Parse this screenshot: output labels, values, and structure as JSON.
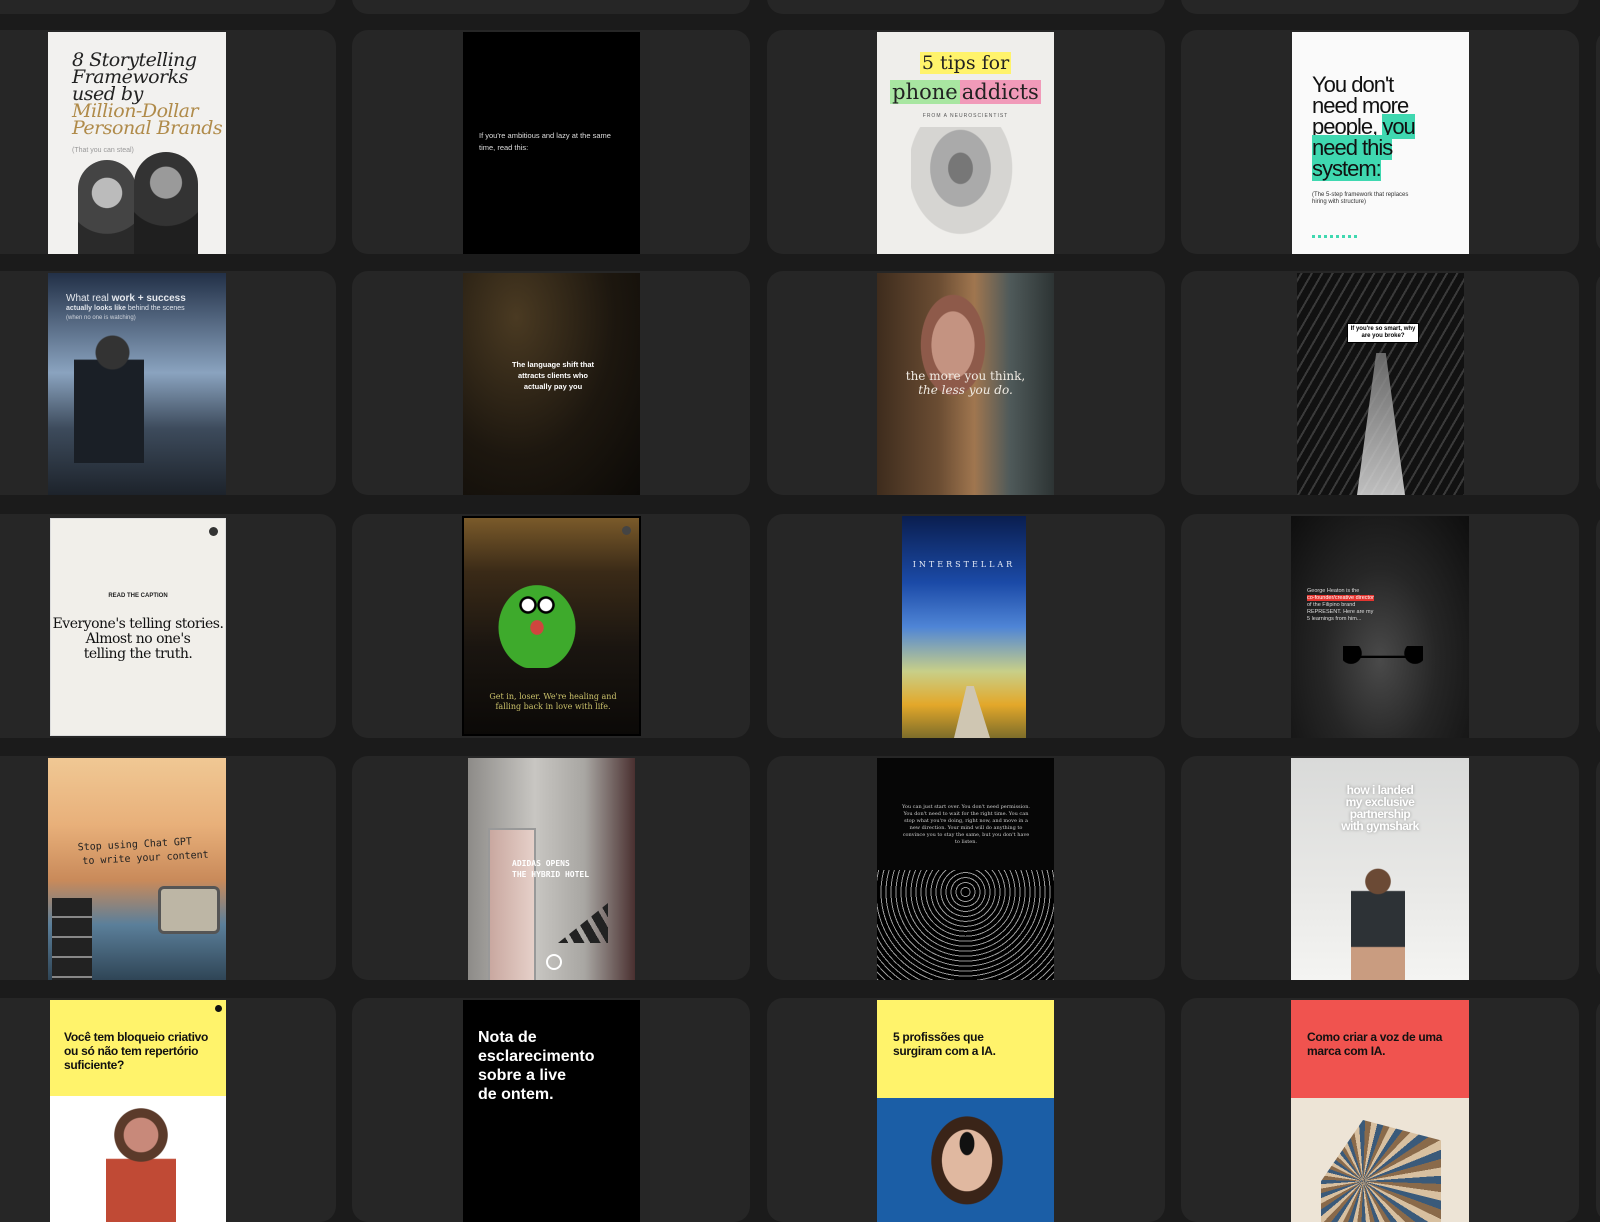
{
  "grid": {
    "rows": [
      {
        "cards": [
          {
            "title_lines": [
              "8 Storytelling",
              "Frameworks",
              "used by"
            ],
            "title_gold": [
              "Million-Dollar",
              "Personal Brands"
            ],
            "subtitle": "(That you can steal)"
          },
          {
            "text": "If you're ambitious and lazy at the same time, read this:"
          },
          {
            "title_a": "5 tips for",
            "title_b1": "phone",
            "title_b2": "addicts",
            "subtitle": "FROM A NEUROSCIENTIST"
          },
          {
            "lines": [
              "You don't",
              "need more",
              "people,"
            ],
            "hl_lines": [
              "you",
              "need this",
              "system:"
            ],
            "subtitle": "(The 5-step framework that replaces hiring with structure)"
          }
        ]
      },
      {
        "cards": [
          {
            "line1_a": "What real ",
            "line1_b": "work + success",
            "line2_a": "actually looks like",
            "line2_b": " behind the scenes",
            "line3": "(when no one is watching)"
          },
          {
            "text": "The language shift that attracts clients who actually pay you"
          },
          {
            "line1": "the more you think,",
            "line2": "the less you do."
          },
          {
            "text": "If you're so smart, why are you broke?"
          }
        ]
      },
      {
        "cards": [
          {
            "kicker": "READ THE CAPTION",
            "lines": [
              "Everyone's telling stories.",
              "Almost no one's",
              "telling the truth."
            ]
          },
          {
            "text": "Get in, loser. We're healing and falling back in love with life."
          },
          {
            "text": "INTERSTELLAR"
          },
          {
            "line1": "George Heaton is the",
            "hl": "co-founder/creative director",
            "line3": "of the Filipino brand",
            "line4": "REPRESENT. Here are my",
            "line5": "5 learnings from him..."
          }
        ]
      },
      {
        "cards": [
          {
            "line1": "Stop using Chat GPT",
            "line2": "to write your content"
          },
          {
            "line1": "ADIDAS OPENS",
            "line2": "THE HYBRID HOTEL"
          },
          {
            "text": "You can just start over. You don't need permission. You don't need to wait for the right time. You can stop what you're doing, right now, and move in a new direction. Your mind will do anything to convince you to stay the same, but you don't have to listen."
          },
          {
            "lines": [
              "how i landed",
              "my exclusive",
              "partnership",
              "with gymshark"
            ]
          }
        ]
      },
      {
        "cards": [
          {
            "text": "Você tem bloqueio criativo ou só não tem repertório suficiente?"
          },
          {
            "lines": [
              "Nota de",
              "esclarecimento",
              "sobre a live",
              "de ontem."
            ]
          },
          {
            "text": "5 profissões que surgiram com a IA."
          },
          {
            "text": "Como criar a voz de uma marca com IA."
          }
        ]
      }
    ]
  },
  "colors": {
    "background": "#1b1b1b",
    "card": "#262626",
    "gold": "#b08b4a",
    "teal": "#3fd8b0",
    "pink": "#f19ab9",
    "green": "#a8e6a1",
    "yellow": "#fff36b",
    "coral": "#f0534f",
    "red": "#e3342f"
  }
}
